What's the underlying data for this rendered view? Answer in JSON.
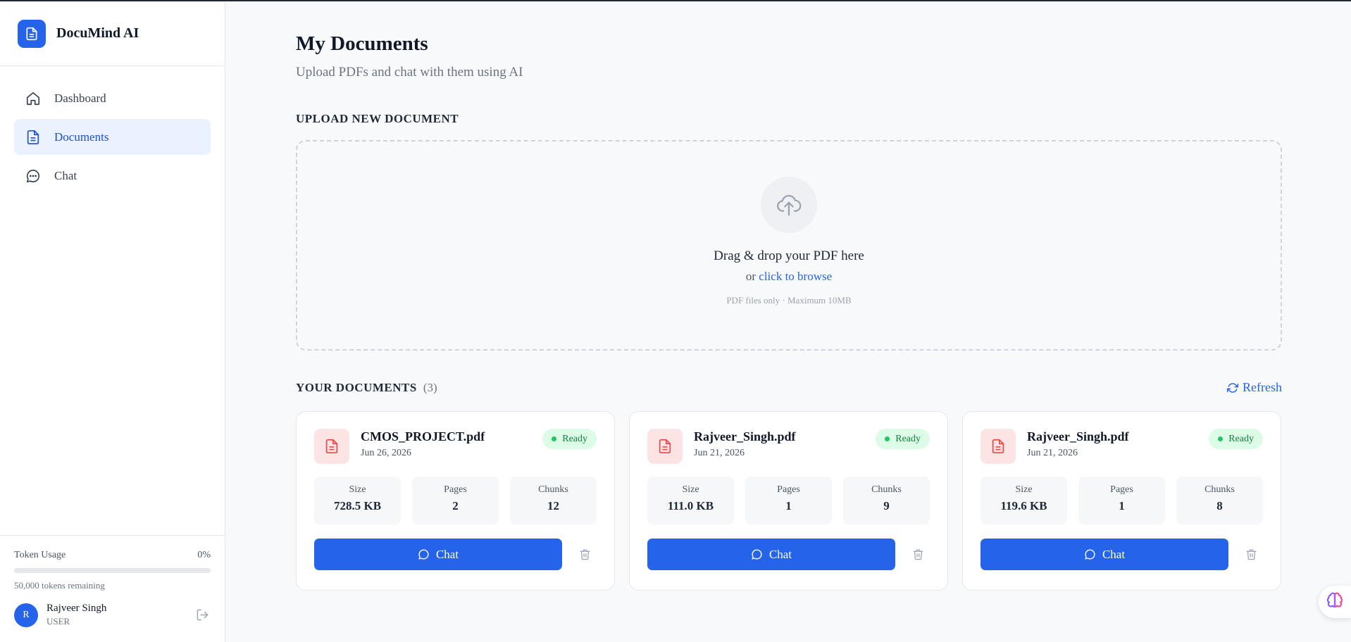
{
  "app": {
    "name": "DocuMind AI",
    "brand_color": "#2563eb"
  },
  "sidebar": {
    "items": [
      {
        "label": "Dashboard",
        "icon": "home-icon",
        "active": false
      },
      {
        "label": "Documents",
        "icon": "document-icon",
        "active": true
      },
      {
        "label": "Chat",
        "icon": "chat-bubble-icon",
        "active": false
      }
    ],
    "token_usage": {
      "label": "Token Usage",
      "percent_text": "0%",
      "fraction": 0,
      "remaining_text": "50,000 tokens remaining"
    },
    "user": {
      "initial": "R",
      "name": "Rajveer Singh",
      "role": "USER"
    }
  },
  "main": {
    "title": "My Documents",
    "subtitle": "Upload PDFs and chat with them using AI",
    "upload": {
      "heading": "UPLOAD NEW DOCUMENT",
      "title": "Drag & drop your PDF here",
      "or_text": "or",
      "browse_link": "click to browse",
      "hint": "PDF files only · Maximum 10MB"
    },
    "documents": {
      "heading": "YOUR DOCUMENTS",
      "count_text": "(3)",
      "refresh_label": "Refresh",
      "status_color": "#22c55e",
      "items": [
        {
          "name": "CMOS_PROJECT.pdf",
          "date": "Jun 26, 2026",
          "status": "Ready",
          "stats": [
            {
              "label": "Size",
              "value": "728.5 KB"
            },
            {
              "label": "Pages",
              "value": "2"
            },
            {
              "label": "Chunks",
              "value": "12"
            }
          ],
          "chat_label": "Chat"
        },
        {
          "name": "Rajveer_Singh.pdf",
          "date": "Jun 21, 2026",
          "status": "Ready",
          "stats": [
            {
              "label": "Size",
              "value": "111.0 KB"
            },
            {
              "label": "Pages",
              "value": "1"
            },
            {
              "label": "Chunks",
              "value": "9"
            }
          ],
          "chat_label": "Chat"
        },
        {
          "name": "Rajveer_Singh.pdf",
          "date": "Jun 21, 2026",
          "status": "Ready",
          "stats": [
            {
              "label": "Size",
              "value": "119.6 KB"
            },
            {
              "label": "Pages",
              "value": "1"
            },
            {
              "label": "Chunks",
              "value": "8"
            }
          ],
          "chat_label": "Chat"
        }
      ]
    }
  },
  "floating_widget": {
    "icon": "brain-icon"
  }
}
